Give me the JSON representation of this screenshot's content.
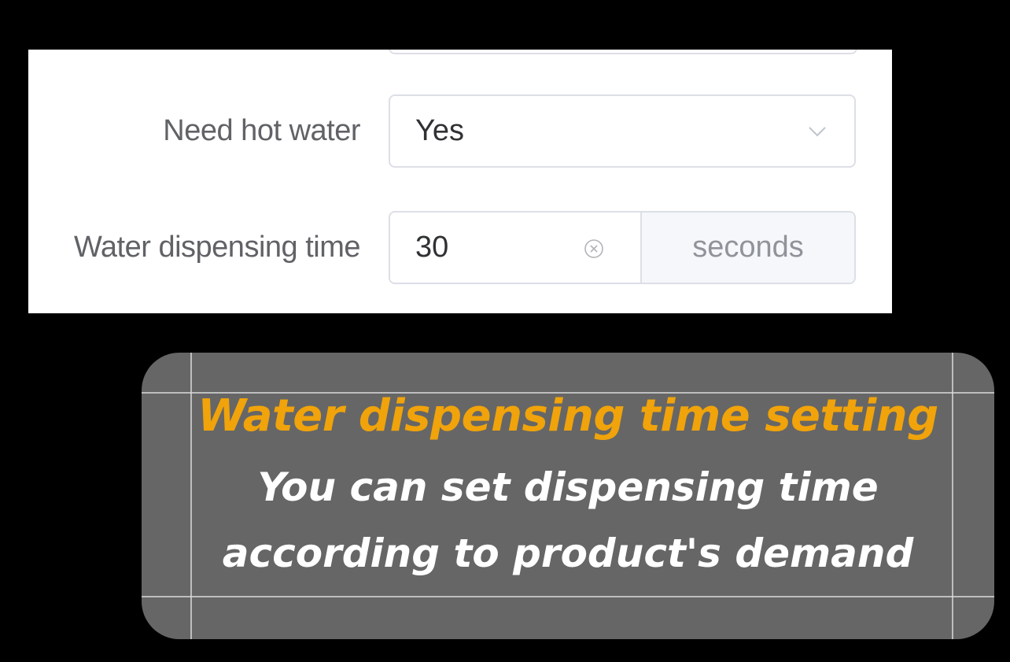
{
  "form": {
    "hot_water": {
      "label": "Need hot water",
      "value": "Yes"
    },
    "dispensing_time": {
      "label": "Water dispensing time",
      "value": "30",
      "unit": "seconds"
    }
  },
  "caption": {
    "title": "Water dispensing time setting",
    "line1": "You can set dispensing time",
    "line2": "according to product's demand"
  },
  "colors": {
    "title_accent": "#f0a30a",
    "caption_bg": "#666666",
    "border": "#dcdfe6",
    "label_text": "#606266",
    "append_bg": "#f5f7fa"
  },
  "icons": {
    "select_arrow": "chevron-down-icon",
    "input_clear": "circle-close-icon"
  }
}
